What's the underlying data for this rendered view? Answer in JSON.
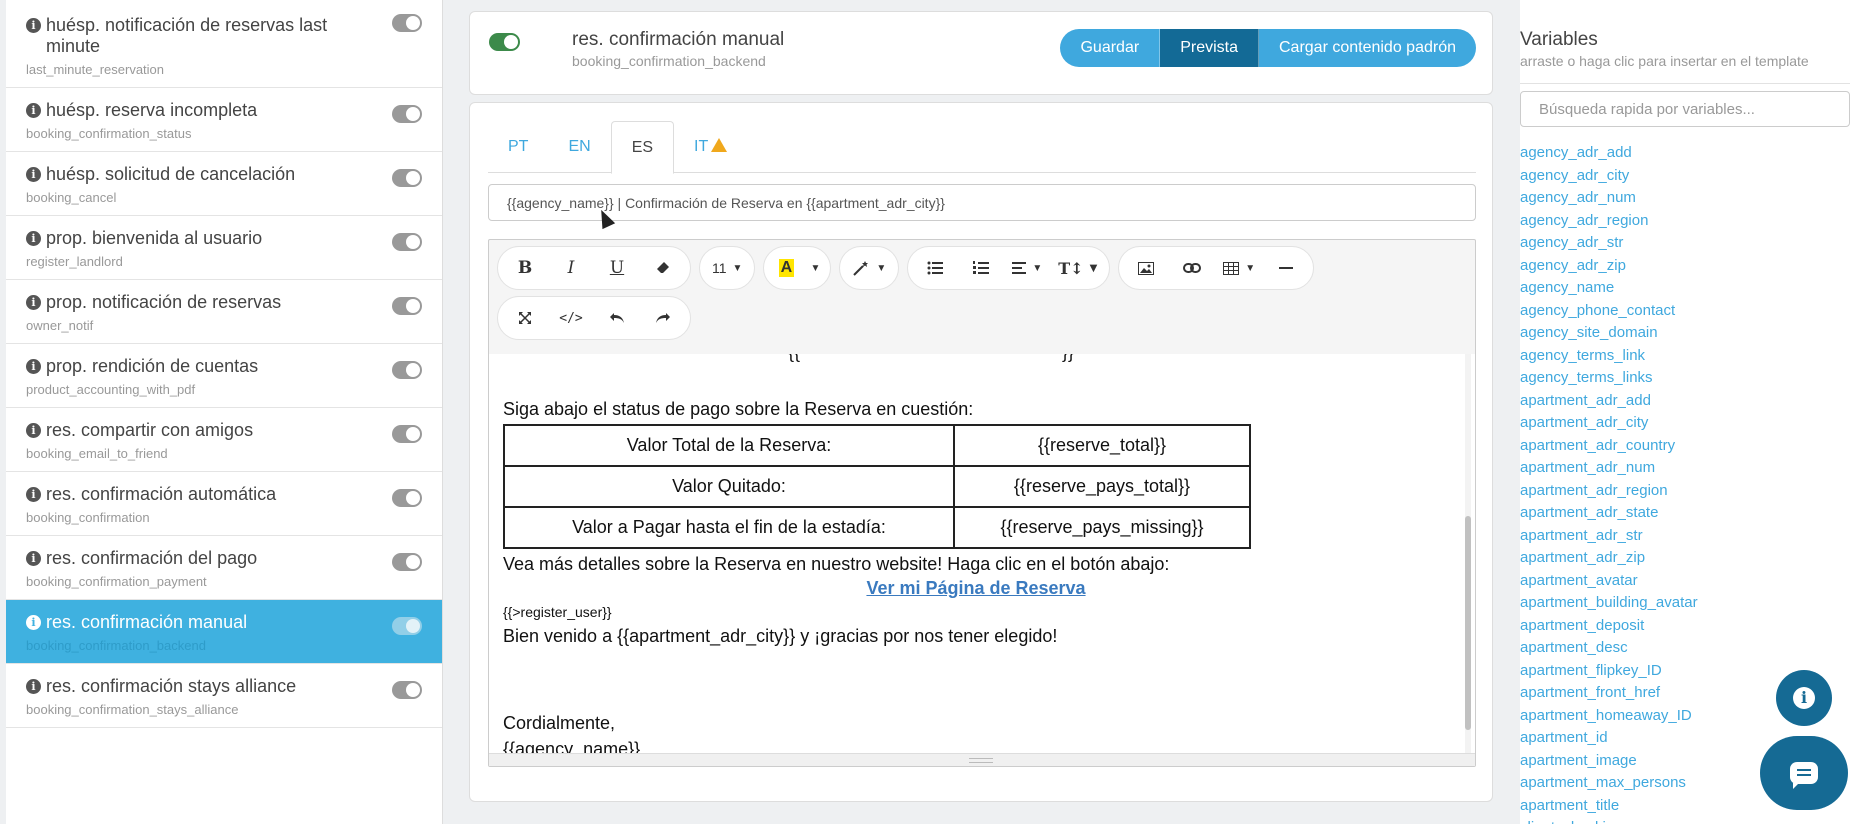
{
  "sidebar": {
    "items": [
      {
        "title": "huésp. notificación de reservas last minute",
        "key": "last_minute_reservation",
        "active": false
      },
      {
        "title": "huésp. reserva incompleta",
        "key": "booking_confirmation_status",
        "active": false
      },
      {
        "title": "huésp. solicitud de cancelación",
        "key": "booking_cancel",
        "active": false
      },
      {
        "title": "prop. bienvenida al usuario",
        "key": "register_landlord",
        "active": false
      },
      {
        "title": "prop. notificación de reservas",
        "key": "owner_notif",
        "active": false
      },
      {
        "title": "prop. rendición de cuentas",
        "key": "product_accounting_with_pdf",
        "active": false
      },
      {
        "title": "res. compartir con amigos",
        "key": "booking_email_to_friend",
        "active": false
      },
      {
        "title": "res. confirmación automática",
        "key": "booking_confirmation",
        "active": false
      },
      {
        "title": "res. confirmación del pago",
        "key": "booking_confirmation_payment",
        "active": false
      },
      {
        "title": "res. confirmación manual",
        "key": "booking_confirmation_backend",
        "active": true
      },
      {
        "title": "res. confirmación stays alliance",
        "key": "booking_confirmation_stays_alliance",
        "active": false
      }
    ]
  },
  "header": {
    "template_name": "res. confirmación manual",
    "template_key": "booking_confirmation_backend",
    "buttons": {
      "save": "Guardar",
      "preview": "Prevista",
      "load_default": "Cargar contenido padrón"
    }
  },
  "editor": {
    "tabs": [
      "PT",
      "EN",
      "ES",
      "IT"
    ],
    "active_tab": "ES",
    "subject": "{{agency_name}} | Confirmación de Reserva en {{apartment_adr_city}}",
    "font_size": "11",
    "icons": {
      "bold": "bold-icon",
      "italic": "italic-icon",
      "underline": "underline-icon",
      "eraser": "eraser-icon",
      "highlight": "highlight-icon",
      "magic": "magic-wand-icon",
      "bullets": "bullet-list-icon",
      "numbers": "numbered-list-icon",
      "align": "align-icon",
      "lineheight": "line-height-icon",
      "image": "image-icon",
      "link": "link-icon",
      "table": "table-icon",
      "hr": "horizontal-rule-icon",
      "fullscreen": "fullscreen-icon",
      "code": "code-view-icon",
      "undo": "undo-icon",
      "redo": "redo-icon"
    },
    "content": {
      "cut_line": "——————  ——————  ———  {{——— ———————— ———}}",
      "p1": "Siga abajo el status de pago sobre la Reserva en cuestión:",
      "table": [
        [
          "Valor Total de la Reserva:",
          "{{reserve_total}}"
        ],
        [
          "Valor Quitado:",
          "{{reserve_pays_total}}"
        ],
        [
          "Valor a Pagar hasta el fin de la estadía:",
          "{{reserve_pays_missing}}"
        ]
      ],
      "p2": "Vea más detalles sobre la Reserva en nuestro website! Haga clic en el botón abajo:",
      "link": "Ver mi Página de Reserva",
      "register": "{{>register_user}}",
      "p3": "Bien venido a {{apartment_adr_city}} y ¡gracias por nos tener elegido!",
      "p4": "Cordialmente,",
      "p5": "{{agency_name}}"
    }
  },
  "variables": {
    "title": "Variables",
    "subtitle": "arraste o haga clic para insertar en el template",
    "search_placeholder": "Búsqueda rapida por variables...",
    "items": [
      "agency_adr_add",
      "agency_adr_city",
      "agency_adr_num",
      "agency_adr_region",
      "agency_adr_str",
      "agency_adr_zip",
      "agency_name",
      "agency_phone_contact",
      "agency_site_domain",
      "agency_terms_link",
      "agency_terms_links",
      "apartment_adr_add",
      "apartment_adr_city",
      "apartment_adr_country",
      "apartment_adr_num",
      "apartment_adr_region",
      "apartment_adr_state",
      "apartment_adr_str",
      "apartment_adr_zip",
      "apartment_avatar",
      "apartment_building_avatar",
      "apartment_deposit",
      "apartment_desc",
      "apartment_flipkey_ID",
      "apartment_front_href",
      "apartment_homeaway_ID",
      "apartment_id",
      "apartment_image",
      "apartment_max_persons",
      "apartment_title",
      "client_checkin"
    ]
  },
  "colors": {
    "accent": "#3fa8de",
    "accent_dark": "#136a96",
    "active_item": "#3fb1e0",
    "toggle_on": "#3c8a4a",
    "warning": "#f0a81c"
  }
}
